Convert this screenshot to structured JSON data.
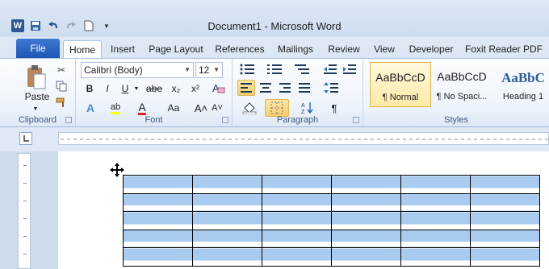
{
  "window": {
    "title": "Document1 - Microsoft Word"
  },
  "quick_access": {
    "app_icon": "W",
    "save_icon": "save-icon",
    "undo_icon": "undo-icon",
    "redo_icon": "redo-icon",
    "new_icon": "new-document-icon"
  },
  "tabs": {
    "file": "File",
    "items": [
      "Home",
      "Insert",
      "Page Layout",
      "References",
      "Mailings",
      "Review",
      "View",
      "Developer",
      "Foxit Reader PDF"
    ],
    "active": "Home"
  },
  "ribbon": {
    "clipboard": {
      "label": "Clipboard",
      "paste": "Paste"
    },
    "font": {
      "label": "Font",
      "font_name": "Calibri (Body)",
      "font_size": "12",
      "bold": "B",
      "italic": "I",
      "underline": "U",
      "strike": "abe",
      "subscript": "x₂",
      "superscript": "x²",
      "grow": "A˄",
      "shrink": "A˅",
      "change_case": "Aa",
      "clear": "A",
      "font_color_letter": "A",
      "highlight": "ab"
    },
    "paragraph": {
      "label": "Paragraph",
      "pilcrow": "¶"
    },
    "styles": {
      "label": "Styles",
      "items": [
        {
          "sample": "AaBbCcD",
          "name": "¶ Normal"
        },
        {
          "sample": "AaBbCcD",
          "name": "¶ No Spaci..."
        },
        {
          "sample": "AaBbC",
          "name": "Heading 1"
        }
      ]
    }
  },
  "colors": {
    "file_tab": "#2a63c2",
    "cell_shading": "#a8cbef",
    "selected_style_border": "#e3b54a"
  },
  "table": {
    "rows": 5,
    "cols": 6
  }
}
